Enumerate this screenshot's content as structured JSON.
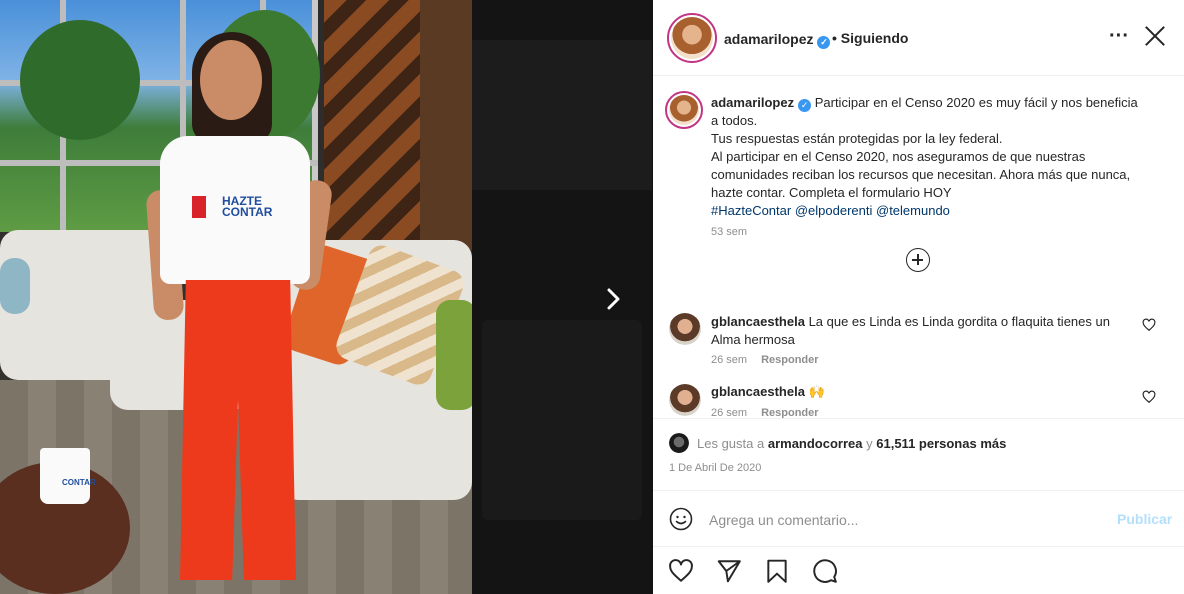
{
  "post": {
    "username": "adamarilopez",
    "follow_status": "• Siguiendo",
    "caption": "Participar en el Censo 2020 es muy fácil y nos beneficia a todos.",
    "caption_line2": "Tus respuestas están protegidas por la ley federal.",
    "caption_line3": "Al participar en el Censo 2020, nos aseguramos de que nuestras comunidades reciban los recursos que necesitan. Ahora más que nunca, hazte contar. Completa el formulario HOY",
    "hashtag": "#HazteContar",
    "mention1": "@elpoderenti",
    "mention2": "@telemundo",
    "caption_time": "53 sem",
    "shirt_text": "HAZTE CONTAR",
    "mug_text": "CONTAR"
  },
  "comments": [
    {
      "username": "gblancaesthela",
      "text": "La que es Linda es Linda gordita o flaquita tienes un Alma hermosa",
      "time": "26 sem",
      "reply": "Responder"
    },
    {
      "username": "gblancaesthela",
      "text": "🙌",
      "time": "26 sem",
      "reply": "Responder"
    }
  ],
  "likes": {
    "prefix": "Les gusta a",
    "user": "armandocorrea",
    "middle": "y",
    "count": "61,511 personas más"
  },
  "date": "1 De Abril De 2020",
  "add_comment": {
    "placeholder": "Agrega un comentario...",
    "publish": "Publicar"
  },
  "icons": {
    "more": "more-icon",
    "close": "close-icon",
    "next": "chevron-right-icon",
    "verified": "verified-icon"
  },
  "colors": {
    "verified": "#3897f0",
    "link": "#00376b",
    "muted": "#8e8e8e",
    "publish_disabled": "#b2dffc",
    "pants": "#ee3a1c"
  }
}
